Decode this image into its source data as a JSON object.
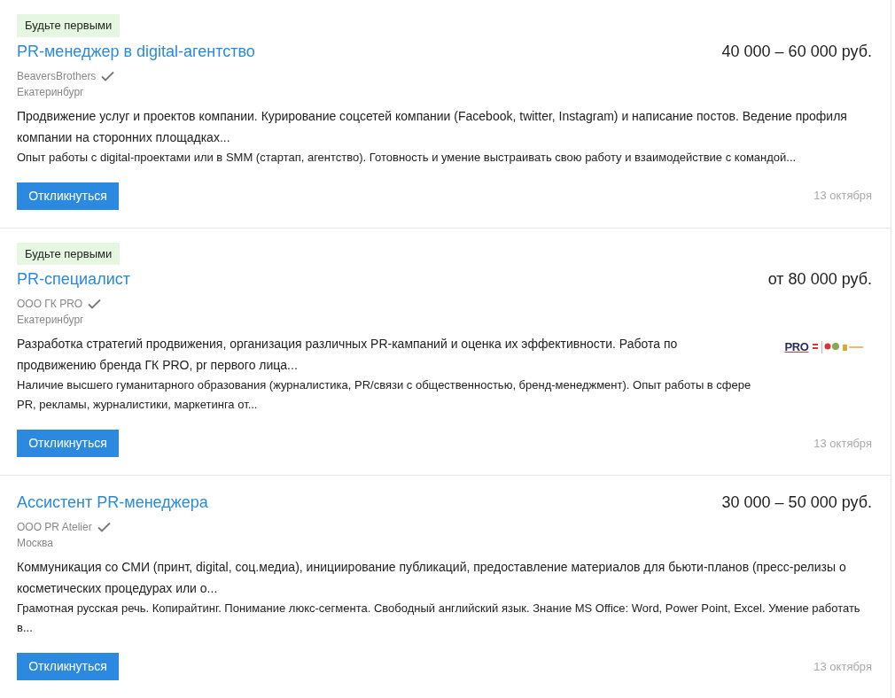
{
  "vacancies": [
    {
      "badge": "Будьте первыми",
      "title": "PR-менеджер в digital-агентство",
      "salary": "40 000 – 60 000 руб.",
      "company": "BeaversBrothers",
      "verified": true,
      "city": "Екатеринбург",
      "responsibilities": "Продвижение услуг и проектов компании. Курирование соцсетей компании (Facebook, twitter, Instagram) и написание постов. Ведение профиля компании на сторонних площадках...",
      "requirements": "Опыт работы с digital-проектами или в SMM (стартап, агентство). Готовность и умение выстраивать свою работу и взаимодействие с командой...",
      "button": "Откликнуться",
      "date": "13 октября"
    },
    {
      "badge": "Будьте первыми",
      "title": "PR-специалист",
      "salary": "от 80 000 руб.",
      "company": "ООО ГК PRO",
      "verified": true,
      "city": "Екатеринбург",
      "logo": {
        "text": "PRO"
      },
      "responsibilities": "Разработка стратегий продвижения, организация различных PR-кампаний и оценка их эффективности. Работа по продвижению бренда ГК PRO, pr первого лица...",
      "requirements": "Наличие высшего гуманитарного образования (журналистика, PR/связи с общественностью, бренд-менеджмент). Опыт работы в сфере PR, рекламы, журналистики, маркетинга от...",
      "button": "Откликнуться",
      "date": "13 октября"
    },
    {
      "title": "Ассистент PR-менеджера",
      "salary": "30 000 – 50 000 руб.",
      "company": "ООО PR Atelier",
      "verified": true,
      "city": "Москва",
      "responsibilities": "Коммуникация со СМИ (принт, digital, соц.медиа), инициирование публикаций, предоставление материалов для бьюти-планов (пресс-релизы о косметических процедурах или о...",
      "requirements": "Грамотная русская речь. Копирайтинг. Понимание люкс-сегмента. Свободный английский язык. Знание MS Office: Word, Power Point, Excel. Умение работать в...",
      "button": "Откликнуться",
      "date": "13 октября"
    }
  ]
}
